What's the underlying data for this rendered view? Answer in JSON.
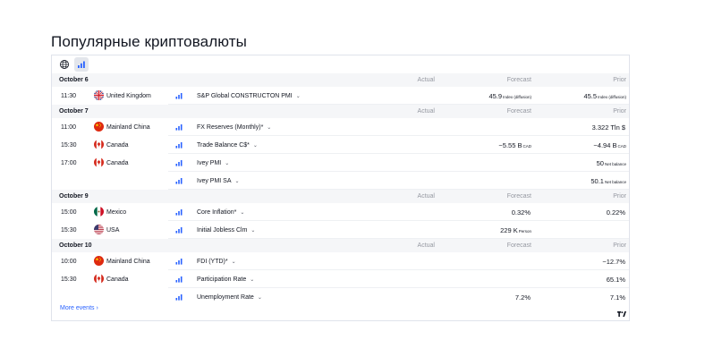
{
  "page": {
    "title": "Популярные криптовалюты"
  },
  "toolbar": {
    "globe_icon": "globe-icon",
    "bars_icon": "importance-bars-icon"
  },
  "columns": {
    "actual": "Actual",
    "forecast": "Forecast",
    "prior": "Prior"
  },
  "groups": [
    {
      "date": "October 6",
      "rows": [
        {
          "time": "11:30",
          "flag": "gb",
          "country": "United Kingdom",
          "event": "S&P Global CONSTRUCTON PMI",
          "chev": "⌄",
          "actual": "",
          "forecast": "45.9",
          "forecast_unit": "Index (diffusion)",
          "prior": "45.5",
          "prior_unit": "Index (diffusion)"
        }
      ]
    },
    {
      "date": "October 7",
      "rows": [
        {
          "time": "11:00",
          "flag": "cn",
          "country": "Mainland China",
          "event": "FX Reserves (Monthly)*",
          "chev": "⌄",
          "actual": "",
          "forecast": "",
          "forecast_unit": "",
          "prior": "3.322 Tln $",
          "prior_unit": ""
        },
        {
          "time": "15:30",
          "flag": "ca",
          "country": "Canada",
          "event": "Trade Balance C$*",
          "chev": "⌄",
          "actual": "",
          "forecast": "−5.55 B",
          "forecast_unit": "CAD",
          "prior": "−4.94 B",
          "prior_unit": "CAD"
        },
        {
          "time": "17:00",
          "flag": "ca",
          "country": "Canada",
          "event": "Ivey PMI",
          "chev": "⌄",
          "actual": "",
          "forecast": "",
          "forecast_unit": "",
          "prior": "50",
          "prior_unit": "Net balance"
        },
        {
          "time": "",
          "flag": "",
          "country": "",
          "event": "Ivey PMI SA",
          "chev": "⌄",
          "actual": "",
          "forecast": "",
          "forecast_unit": "",
          "prior": "50.1",
          "prior_unit": "Net balance"
        }
      ]
    },
    {
      "date": "October 9",
      "rows": [
        {
          "time": "15:00",
          "flag": "mx",
          "country": "Mexico",
          "event": "Core Inflation*",
          "chev": "⌄",
          "actual": "",
          "forecast": "0.32%",
          "forecast_unit": "",
          "prior": "0.22%",
          "prior_unit": ""
        },
        {
          "time": "15:30",
          "flag": "us",
          "country": "USA",
          "event": "Initial Jobless Clm",
          "chev": "⌄",
          "actual": "",
          "forecast": "229 K",
          "forecast_unit": "Person",
          "prior": "",
          "prior_unit": ""
        }
      ]
    },
    {
      "date": "October 10",
      "rows": [
        {
          "time": "10:00",
          "flag": "cn",
          "country": "Mainland China",
          "event": "FDI (YTD)*",
          "chev": "⌄",
          "actual": "",
          "forecast": "",
          "forecast_unit": "",
          "prior": "−12.7%",
          "prior_unit": ""
        },
        {
          "time": "15:30",
          "flag": "ca",
          "country": "Canada",
          "event": "Participation Rate",
          "chev": "⌄",
          "actual": "",
          "forecast": "",
          "forecast_unit": "",
          "prior": "65.1%",
          "prior_unit": ""
        },
        {
          "time": "",
          "flag": "",
          "country": "",
          "event": "Unemployment Rate",
          "chev": "⌄",
          "actual": "",
          "forecast": "7.2%",
          "forecast_unit": "",
          "prior": "7.1%",
          "prior_unit": ""
        }
      ]
    }
  ],
  "footer": {
    "more_label": "More events",
    "chev": "›",
    "logo_icon": "tradingview-logo-icon"
  },
  "colors": {
    "accent": "#2962ff",
    "importance": "#2962ff",
    "muted": "#9598a1",
    "header_bg": "#f5f6f8"
  }
}
